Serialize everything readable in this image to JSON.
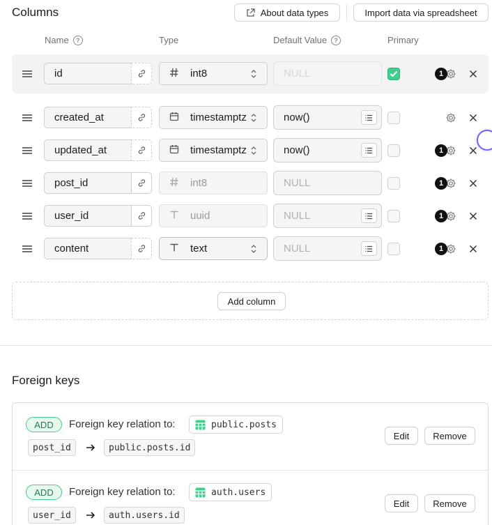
{
  "header": {
    "title": "Columns",
    "about_label": "About data types",
    "import_label": "Import data via spreadsheet"
  },
  "column_headers": {
    "name": "Name",
    "type": "Type",
    "default_value": "Default Value",
    "primary": "Primary"
  },
  "columns": [
    {
      "name": "id",
      "type": "int8",
      "type_icon": "hash-icon",
      "default": "NULL",
      "primary": true,
      "badge_count": "1",
      "link_style": "dashed",
      "has_list_button": false,
      "editable_type": true
    },
    {
      "name": "created_at",
      "type": "timestamptz",
      "type_icon": "calendar-icon",
      "default": "now()",
      "primary": false,
      "badge_count": "",
      "link_style": "dashed",
      "has_list_button": true,
      "editable_type": true
    },
    {
      "name": "updated_at",
      "type": "timestamptz",
      "type_icon": "calendar-icon",
      "default": "now()",
      "primary": false,
      "badge_count": "1",
      "link_style": "dashed",
      "has_list_button": true,
      "editable_type": true
    },
    {
      "name": "post_id",
      "type": "int8",
      "type_icon": "hash-icon",
      "default": "NULL",
      "primary": false,
      "badge_count": "1",
      "link_style": "solid",
      "has_list_button": false,
      "editable_type": false
    },
    {
      "name": "user_id",
      "type": "uuid",
      "type_icon": "text-type-icon",
      "default": "NULL",
      "primary": false,
      "badge_count": "1",
      "link_style": "solid",
      "has_list_button": true,
      "editable_type": false
    },
    {
      "name": "content",
      "type": "text",
      "type_icon": "text-type-icon",
      "default": "NULL",
      "primary": false,
      "badge_count": "1",
      "link_style": "dashed",
      "has_list_button": true,
      "editable_type": true
    }
  ],
  "add_column_label": "Add column",
  "foreign_keys": {
    "title": "Foreign keys",
    "relations": [
      {
        "badge": "ADD",
        "text": "Foreign key relation to:",
        "table": "public.posts",
        "source": "post_id",
        "target": "public.posts.id",
        "edit": "Edit",
        "remove": "Remove"
      },
      {
        "badge": "ADD",
        "text": "Foreign key relation to:",
        "table": "auth.users",
        "source": "user_id",
        "target": "auth.users.id",
        "edit": "Edit",
        "remove": "Remove"
      }
    ]
  },
  "colors": {
    "primary_green": "#3ecf8e",
    "badge_bg": "#e7f8ef",
    "text": "#1c1c1c"
  }
}
